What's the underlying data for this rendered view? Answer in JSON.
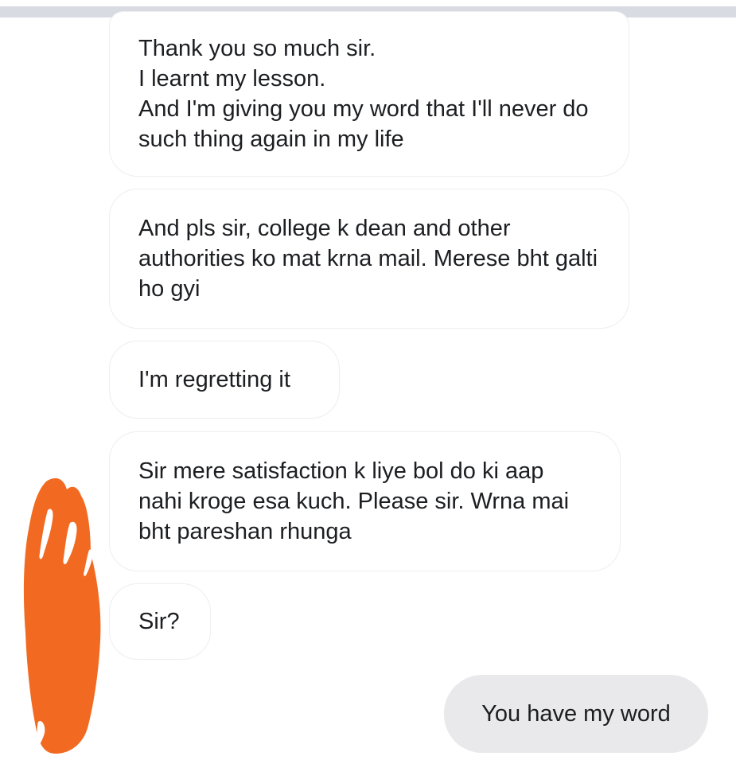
{
  "conversation": {
    "messages": [
      {
        "direction": "incoming",
        "text": "Thank you so much sir.\nI learnt my lesson.\nAnd I'm giving you my word that I'll never do such thing again in my life"
      },
      {
        "direction": "incoming",
        "text": "And pls sir, college k dean and other authorities ko mat krna mail. Merese bht galti ho gyi"
      },
      {
        "direction": "incoming",
        "text": "I'm regretting it"
      },
      {
        "direction": "incoming",
        "text": "Sir mere satisfaction k liye bol do ki aap nahi kroge esa kuch. Please sir. Wrna mai bht pareshan rhunga"
      },
      {
        "direction": "incoming",
        "text": "Sir?"
      },
      {
        "direction": "outgoing",
        "text": "You have my word"
      }
    ]
  },
  "colors": {
    "incoming_bubble": "#ffffff",
    "incoming_border": "#eceef1",
    "outgoing_bubble": "#e9e9eb",
    "text": "#1c1e21",
    "redaction": "#f26a21"
  }
}
